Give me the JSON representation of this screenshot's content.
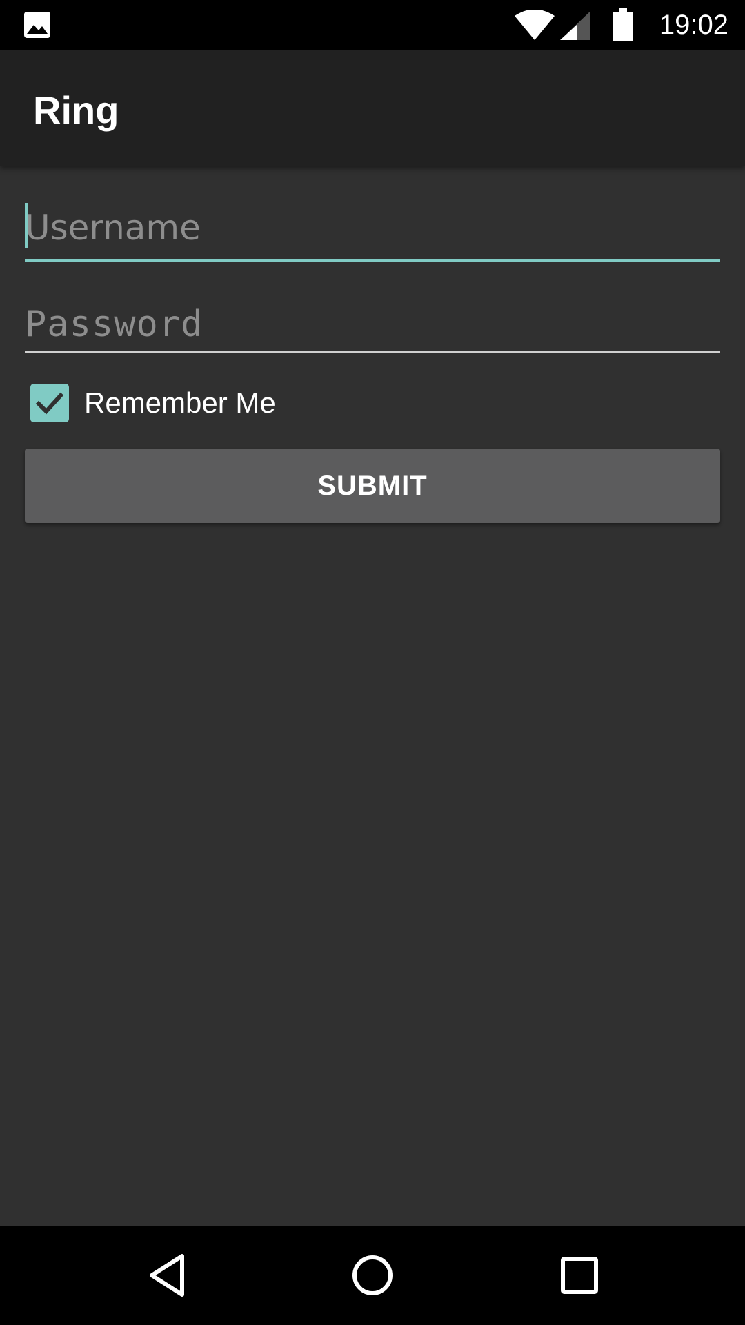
{
  "status_bar": {
    "time": "19:02",
    "icons": [
      "gallery-icon",
      "wifi-icon",
      "signal-icon",
      "battery-icon"
    ]
  },
  "app_bar": {
    "title": "Ring"
  },
  "form": {
    "username": {
      "placeholder": "Username",
      "value": ""
    },
    "password": {
      "placeholder": "Password",
      "value": ""
    },
    "remember_me": {
      "label": "Remember Me",
      "checked": true
    },
    "submit_label": "SUBMIT"
  },
  "nav_bar": {
    "icons": [
      "back-icon",
      "home-icon",
      "recents-icon"
    ]
  },
  "colors": {
    "accent": "#80cbc4",
    "background": "#303030",
    "app_bar": "#212121",
    "button": "#5c5c5d"
  }
}
